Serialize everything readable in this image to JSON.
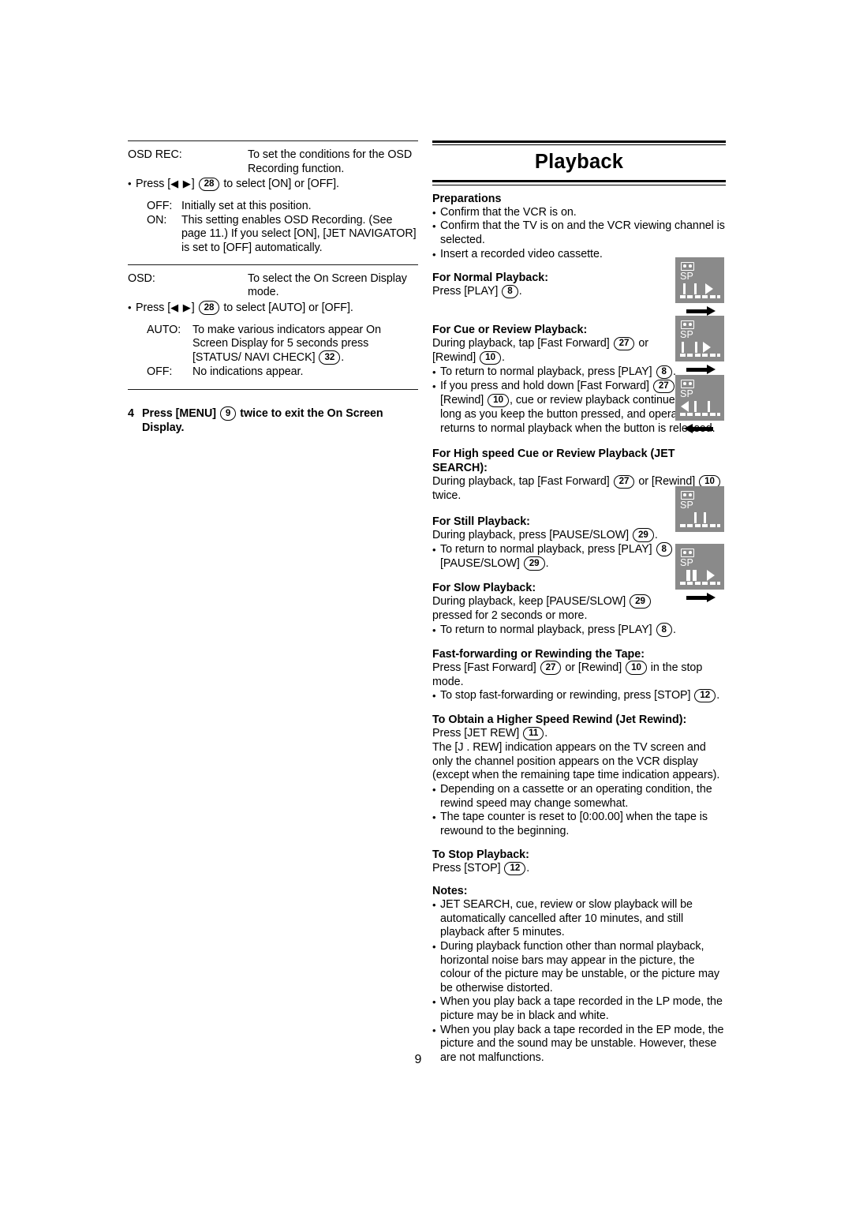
{
  "page_number": "9",
  "left_column": {
    "osd_rec": {
      "label": "OSD REC:",
      "description_line1": "To set the conditions for the OSD",
      "description_line2": "Recording function.",
      "press_bullet": {
        "bullet": "•",
        "press_word": "Press [",
        "arrows": "◀ ▶",
        "close_bracket": "]",
        "key": "28",
        "tail": "to select [ON] or [OFF]."
      },
      "options": [
        {
          "name": "OFF:",
          "text": "Initially set at this position."
        },
        {
          "name": "ON:",
          "text": "This setting enables OSD Recording. (See page 11.) If you select [ON], [JET NAVIGATOR] is set to [OFF] automatically."
        }
      ]
    },
    "osd": {
      "label": "OSD:",
      "description_line1": "To select the On Screen Display",
      "description_line2": "mode.",
      "press_bullet": {
        "bullet": "•",
        "press_word": "Press [",
        "arrows": "◀ ▶",
        "close_bracket": "]",
        "key": "28",
        "tail": "to select [AUTO] or [OFF]."
      },
      "options": [
        {
          "name": "AUTO:",
          "text_before_key": "To make various indicators appear On Screen Display for 5 seconds press [STATUS/ NAVI CHECK]",
          "key": "32",
          "text_after_key": "."
        },
        {
          "name": "OFF:",
          "text": "No indications appear."
        }
      ]
    },
    "step4": {
      "number": "4",
      "text_before_key": "Press [MENU]",
      "key": "9",
      "text_after_key": "twice to exit the On Screen Display."
    }
  },
  "right_column": {
    "title": "Playback",
    "preparations": {
      "heading": "Preparations",
      "items": [
        "Confirm that the VCR is on.",
        "Confirm that the TV is on and the VCR viewing channel is selected.",
        "Insert a recorded video cassette."
      ]
    },
    "normal_playback": {
      "heading": "For Normal Playback:",
      "line_before_key": "Press [PLAY]",
      "key": "8",
      "line_after_key": "."
    },
    "cue_review": {
      "heading": "For Cue or Review Playback:",
      "line1_a": "During playback, tap [Fast Forward]",
      "line1_key": "27",
      "line1_b": "or",
      "line2_a": "[Rewind]",
      "line2_key": "10",
      "line2_b": ".",
      "bullet1_a": "To return to normal playback, press [PLAY]",
      "bullet1_key": "8",
      "bullet1_b": ".",
      "bullet2_a": "If you press and hold down [Fast Forward]",
      "bullet2_key1": "27",
      "bullet2_b": "or [Rewind]",
      "bullet2_key2": "10",
      "bullet2_c": ", cue or review playback continues for as long as you keep the button pressed, and operation returns to normal playback when the button is released."
    },
    "jet_search": {
      "heading": "For High speed Cue or Review Playback (JET SEARCH):",
      "line_a": "During playback, tap [Fast Forward]",
      "key1": "27",
      "line_b": "or [Rewind]",
      "key2": "10",
      "line_c": "twice."
    },
    "still_playback": {
      "heading": "For Still Playback:",
      "line_a": "During playback, press [PAUSE/SLOW]",
      "key1": "29",
      "line_b": ".",
      "bullet_a": "To return to normal playback, press [PLAY]",
      "key2": "8",
      "bullet_b": "or [PAUSE/SLOW]",
      "key3": "29",
      "bullet_c": "."
    },
    "slow_playback": {
      "heading": "For Slow Playback:",
      "line_a": "During playback, keep [PAUSE/SLOW]",
      "key1": "29",
      "line_b": "pressed for 2 seconds or more.",
      "bullet_a": "To return to normal playback, press [PLAY]",
      "key2": "8",
      "bullet_b": "."
    },
    "fast_forward_rewind": {
      "heading": "Fast-forwarding or Rewinding the Tape:",
      "line_a": "Press [Fast Forward]",
      "key1": "27",
      "line_b": "or [Rewind]",
      "key2": "10",
      "line_c": "in the stop mode.",
      "bullet_a": "To stop fast-forwarding or rewinding, press [STOP]",
      "key3": "12",
      "bullet_b": "."
    },
    "jet_rewind": {
      "heading": "To Obtain a Higher Speed Rewind (Jet Rewind):",
      "line_a": "Press [JET REW]",
      "key1": "11",
      "line_b": ".",
      "paragraph": "The [J . REW] indication appears on the TV screen and only the channel position appears on the VCR display (except when the remaining tape time indication appears).",
      "bullets": [
        "Depending on a cassette or an operating condition, the rewind speed may change somewhat.",
        "The tape counter is reset to [0:00.00] when the tape is rewound to the beginning."
      ]
    },
    "stop_playback": {
      "heading": "To Stop Playback:",
      "line_a": "Press [STOP]",
      "key1": "12",
      "line_b": "."
    },
    "notes": {
      "heading": "Notes:",
      "items": [
        "JET SEARCH, cue, review or slow playback will be automatically cancelled after 10 minutes, and still playback after 5 minutes.",
        "During playback function other than normal playback, horizontal noise bars may appear in the picture, the colour of the picture may be unstable, or the picture may be otherwise distorted.",
        "When you play back a tape recorded in the LP mode, the picture may be in black and white.",
        "When you play back a tape recorded in the EP mode, the picture and the sound may be unstable. However, these are not malfunctions."
      ]
    },
    "vcr_displays": {
      "mode_label": "SP",
      "panel_play": "play",
      "panel_cue": "cue",
      "panel_review": "review",
      "panel_still": "still",
      "panel_slow": "slow"
    }
  }
}
